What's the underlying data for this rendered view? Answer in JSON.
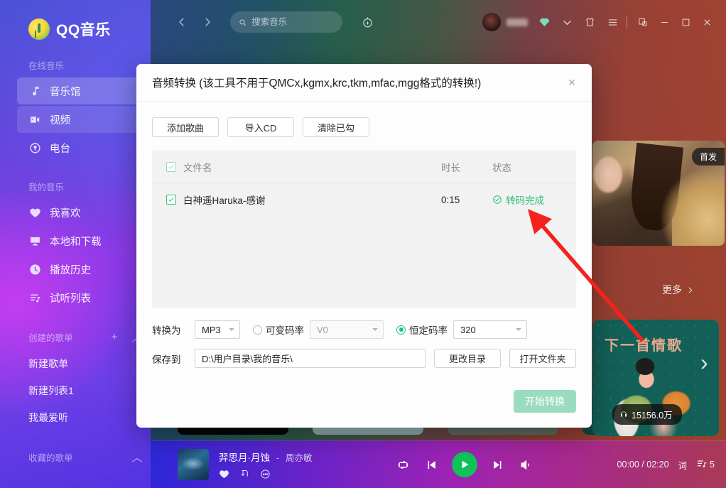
{
  "app": {
    "name": "QQ音乐"
  },
  "sidebar": {
    "sections": [
      {
        "label": "在线音乐"
      },
      {
        "label": "我的音乐"
      },
      {
        "label": "创建的歌单",
        "add": "+",
        "collapse": "︿"
      },
      {
        "label": "收藏的歌单",
        "collapse": "︿"
      }
    ],
    "online": [
      {
        "label": "音乐馆",
        "icon": "music-note-icon",
        "state": "active"
      },
      {
        "label": "视频",
        "icon": "video-icon",
        "state": "highlight"
      },
      {
        "label": "电台",
        "icon": "radio-icon",
        "state": "normal"
      }
    ],
    "mine": [
      {
        "label": "我喜欢",
        "icon": "heart-icon"
      },
      {
        "label": "本地和下载",
        "icon": "monitor-icon"
      },
      {
        "label": "播放历史",
        "icon": "clock-icon"
      },
      {
        "label": "试听列表",
        "icon": "playlist-icon"
      }
    ],
    "playlists": [
      {
        "label": "新建歌单"
      },
      {
        "label": "新建列表1"
      },
      {
        "label": "我最爱听"
      }
    ]
  },
  "topbar": {
    "back_icon": "chevron-left-icon",
    "forward_icon": "chevron-right-icon",
    "search": {
      "placeholder": "搜索音乐",
      "value": "",
      "icon": "search-icon"
    },
    "discover_icon": "compass-icon",
    "vip_icon": "diamond-icon",
    "chevron_icon": "chevron-down-icon",
    "skin_icon": "shirt-icon",
    "menu_icon": "hamburger-icon",
    "mini_icon": "mini-window-icon",
    "minimize_icon": "minimize-icon",
    "maximize_icon": "maximize-icon",
    "close_icon": "close-icon"
  },
  "content": {
    "first_release_badge": "首发",
    "more_label": "更多",
    "more_icon": "chevron-right-icon",
    "song_card": {
      "title": "下一首情歌",
      "listen_count": "15156.0万",
      "headphone_icon": "headphone-icon"
    },
    "next_page_icon": "chevron-right-icon"
  },
  "modal": {
    "title": "音频转换 (该工具不用于QMCx,kgmx,krc,tkm,mfac,mgg格式的转换!)",
    "close_icon": "close-icon",
    "toolbar": [
      {
        "label": "添加歌曲"
      },
      {
        "label": "导入CD"
      },
      {
        "label": "清除已勾"
      }
    ],
    "table": {
      "headers": {
        "name": "文件名",
        "duration": "时长",
        "status": "状态"
      },
      "rows": [
        {
          "checked": true,
          "name": "白神遥Haruka-感谢",
          "duration": "0:15",
          "status": "转码完成",
          "status_icon": "check-circle-icon"
        }
      ]
    },
    "convert_row": {
      "label": "转换为",
      "format": {
        "value": "MP3"
      },
      "vbr": {
        "label": "可变码率",
        "selected": false,
        "value": "V0",
        "disabled": true
      },
      "cbr": {
        "label": "恒定码率",
        "selected": true,
        "value": "320"
      }
    },
    "save_row": {
      "label": "保存到",
      "path": "D:\\用户目录\\我的音乐\\",
      "change_dir": "更改目录",
      "open_folder": "打开文件夹"
    },
    "start_button": "开始转换"
  },
  "player": {
    "song_title": "羿思月·月蚀",
    "dash": "-",
    "artist": "周亦敏",
    "like_icon": "heart-icon",
    "download_icon": "download-icon",
    "more_icon": "ellipsis-icon",
    "repeat_icon": "repeat-icon",
    "prev_icon": "previous-icon",
    "play_icon": "play-icon",
    "next_icon": "next-icon",
    "volume_icon": "volume-icon",
    "time": "00:00 / 02:20",
    "lyric_label": "词",
    "queue_icon": "playlist-icon",
    "queue_count": "5"
  },
  "annotation": {
    "arrow_color": "#f3221c"
  }
}
